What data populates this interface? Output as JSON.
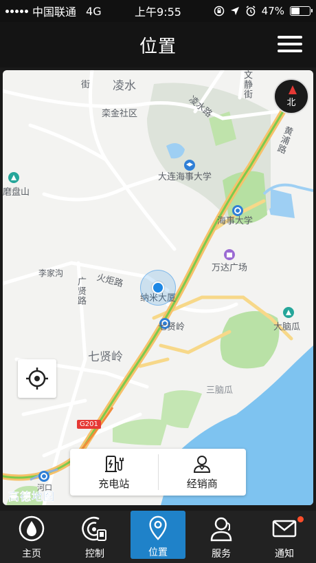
{
  "status_bar": {
    "carrier": "中国联通",
    "network": "4G",
    "time": "上午9:55",
    "battery": "47%",
    "battery_level": 0.47
  },
  "header": {
    "title": "位置"
  },
  "map": {
    "labels": {
      "lingshui": "凌水",
      "lingshui_road": "凌水路",
      "lijin": "栾金社区",
      "dmu": "大连海事大学",
      "dmu_station": "海事大学",
      "wanda": "万达广场",
      "huoju_road": "火炬路",
      "guangxian_road": "广贤路",
      "lijia": "李家沟",
      "nami": "纳米大厦",
      "qixianling_station": "七贤岭",
      "qixianling": "七贤岭",
      "danao": "大脑瓜",
      "sannao": "三脑瓜",
      "moshan": "磨盘山",
      "huangpu_road": "黄浦路",
      "wenjing": "文静街",
      "jie": "街",
      "g201": "G201",
      "hekou": "河口"
    },
    "compass_label": "北",
    "logo": "高德地图"
  },
  "actions": {
    "charging": "充电站",
    "dealer": "经销商"
  },
  "tabs": [
    {
      "label": "主页",
      "icon": "home-drop-icon"
    },
    {
      "label": "控制",
      "icon": "control-icon"
    },
    {
      "label": "位置",
      "icon": "location-icon",
      "active": true
    },
    {
      "label": "服务",
      "icon": "service-icon"
    },
    {
      "label": "通知",
      "icon": "mail-icon",
      "badge": true
    }
  ],
  "colors": {
    "accent": "#1f82c9",
    "badge": "#ff4d2a",
    "location_dot": "#1e88e5"
  }
}
